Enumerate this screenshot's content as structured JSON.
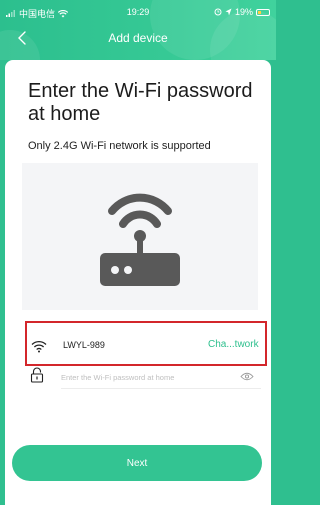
{
  "status_bar": {
    "carrier": "中国电信",
    "time": "19:29",
    "battery": "19%"
  },
  "nav": {
    "title": "Add device",
    "back_icon": "chevron-left-icon"
  },
  "page": {
    "title": "Enter the Wi-Fi password at home",
    "subtitle": "Only 2.4G Wi-Fi network is supported"
  },
  "wifi": {
    "ssid": "LWYL-989",
    "change_label": "Cha...twork",
    "password_placeholder": "Enter the Wi-Fi password at home",
    "password_value": ""
  },
  "actions": {
    "next_label": "Next"
  },
  "colors": {
    "accent": "#2dbf8d",
    "highlight": "#d3262b",
    "illustration_bg": "#f4f5f7",
    "router": "#595959"
  }
}
